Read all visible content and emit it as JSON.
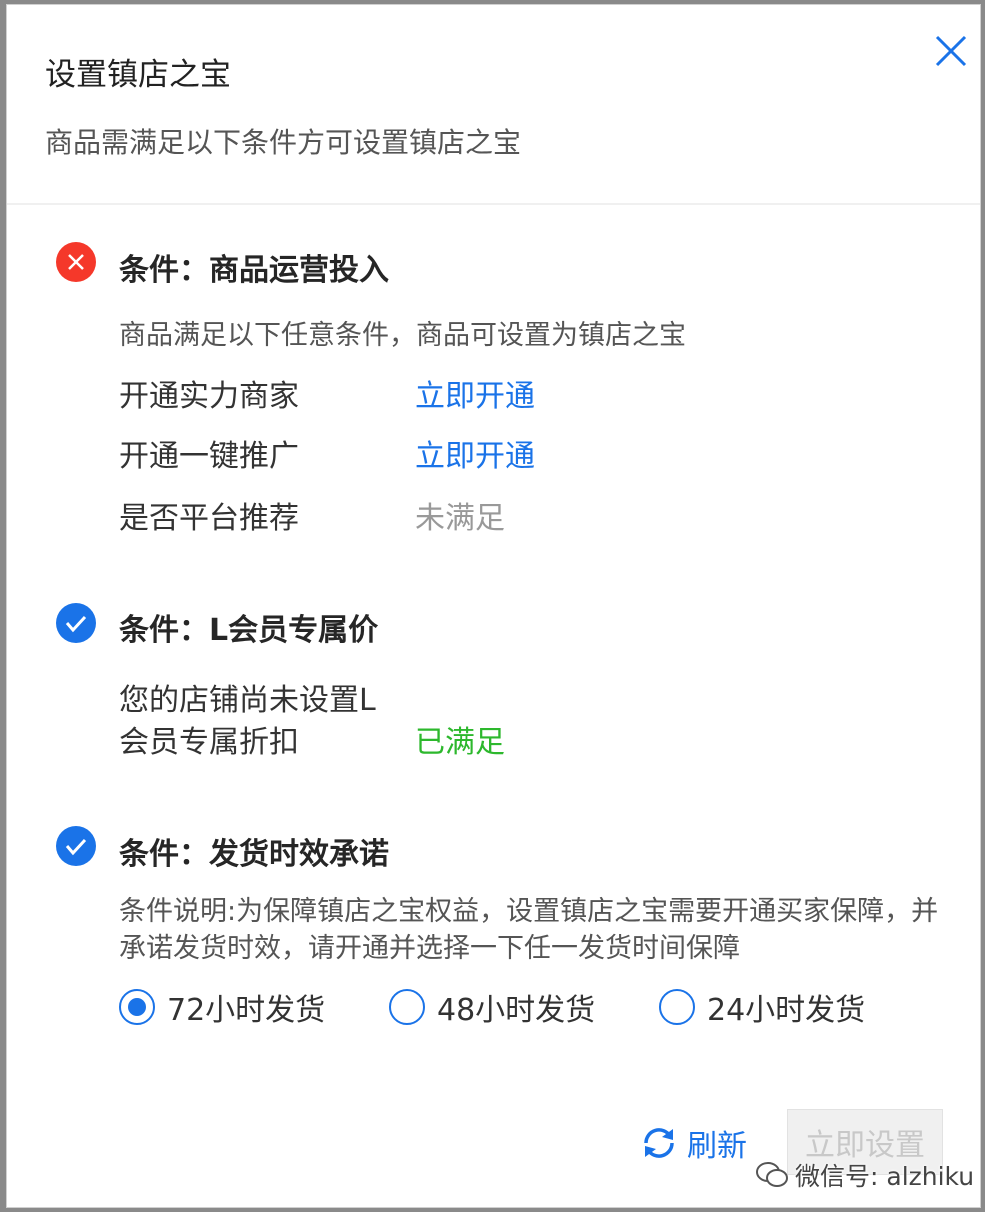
{
  "dialog": {
    "title": "设置镇店之宝",
    "subtitle": "商品需满足以下条件方可设置镇店之宝"
  },
  "conditions": [
    {
      "status": "failed",
      "title": "条件：商品运营投入",
      "description": "商品满足以下任意条件，商品可设置为镇店之宝",
      "rows": [
        {
          "label": "开通实力商家",
          "action": "立即开通"
        },
        {
          "label": "开通一键推广",
          "action": "立即开通"
        },
        {
          "label": "是否平台推荐",
          "status": "未满足"
        }
      ]
    },
    {
      "status": "passed",
      "title": "条件：L会员专属价",
      "label_line1": "您的店铺尚未设置L",
      "label_line2": "会员专属折扣",
      "status_text": "已满足"
    },
    {
      "status": "passed",
      "title": "条件：发货时效承诺",
      "description": "条件说明:为保障镇店之宝权益，设置镇店之宝需要开通买家保障，并承诺发货时效，请开通并选择一下任一发货时间保障",
      "options": [
        {
          "label": "72小时发货",
          "selected": true
        },
        {
          "label": "48小时发货",
          "selected": false
        },
        {
          "label": "24小时发货",
          "selected": false
        }
      ]
    }
  ],
  "footer": {
    "refresh_label": "刷新",
    "confirm_label": "立即设置",
    "confirm_disabled": true
  },
  "watermark": {
    "text": "微信号: alzhiku"
  },
  "colors": {
    "accent": "#1a73e8",
    "error": "#f5382a",
    "success": "#2db82d"
  },
  "icons": {
    "close": "close-icon",
    "error": "error-circle-icon",
    "success": "check-circle-icon",
    "refresh": "refresh-icon",
    "wechat": "wechat-icon"
  }
}
